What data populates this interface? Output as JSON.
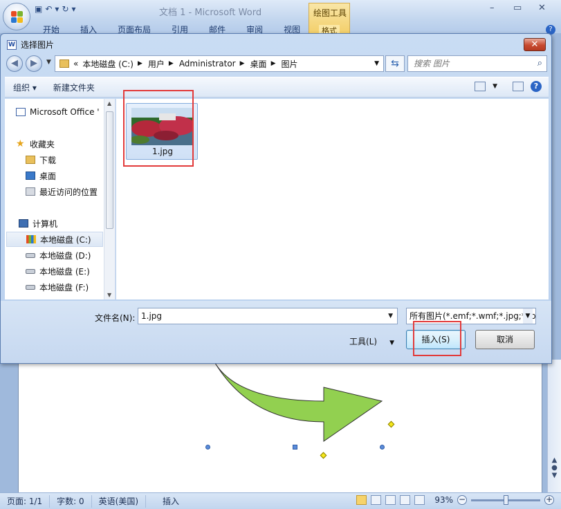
{
  "word": {
    "title": "文档 1 - Microsoft Word",
    "context_tab_group": "绘图工具",
    "context_tab": "格式",
    "ribbon_tabs": [
      "开始",
      "插入",
      "页面布局",
      "引用",
      "邮件",
      "审阅",
      "视图"
    ],
    "win_min": "–",
    "win_max": "▭",
    "win_close": "✕",
    "help": "?"
  },
  "dialog": {
    "title": "选择图片",
    "close": "✕",
    "address": {
      "lead": "«",
      "crumbs": [
        "本地磁盘 (C:)",
        "用户",
        "Administrator",
        "桌面",
        "图片"
      ]
    },
    "search_placeholder": "搜索 图片",
    "toolbar": {
      "organize": "组织",
      "new_folder": "新建文件夹"
    },
    "nav": {
      "items": [
        {
          "label": "Microsoft Office '",
          "icon": "word-doc-icon"
        },
        {
          "label": "收藏夹",
          "icon": "star-icon"
        },
        {
          "label": "下载",
          "icon": "folder-download-icon"
        },
        {
          "label": "桌面",
          "icon": "desktop-icon"
        },
        {
          "label": "最近访问的位置",
          "icon": "recent-places-icon"
        },
        {
          "label": "计算机",
          "icon": "computer-icon"
        },
        {
          "label": "本地磁盘 (C:)",
          "icon": "windows-drive-icon"
        },
        {
          "label": "本地磁盘 (D:)",
          "icon": "drive-icon"
        },
        {
          "label": "本地磁盘 (E:)",
          "icon": "drive-icon"
        },
        {
          "label": "本地磁盘 (F:)",
          "icon": "drive-icon"
        }
      ]
    },
    "file": {
      "name": "1.jpg"
    },
    "filename_label": "文件名(N):",
    "filename_value": "1.jpg",
    "filter_value": "所有图片(*.emf;*.wmf;*.jpg;*.jpeg;*.jfif;*.jpe;*.png)",
    "tools_label": "工具(L)",
    "insert_label": "插入(S)",
    "cancel_label": "取消"
  },
  "status": {
    "page": "页面: 1/1",
    "words": "字数: 0",
    "language": "英语(美国)",
    "mode": "插入",
    "zoom": "93%",
    "zoom_fraction": 0.5
  },
  "colors": {
    "accent_red": "#e23a3a",
    "shape_fill": "#92d050",
    "dialog_frame": "#b9d0ee"
  }
}
